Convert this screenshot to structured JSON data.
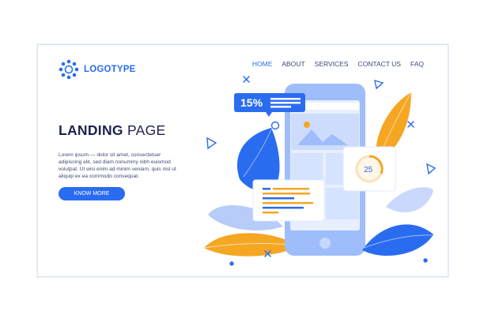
{
  "brand": {
    "logo_text": "LOGOTYPE"
  },
  "nav": {
    "home": "HOME",
    "about": "ABOUT",
    "services": "SERVICES",
    "contact": "CONTACT US",
    "faq": "FAQ"
  },
  "hero": {
    "title_bold": "LANDING",
    "title_light": " PAGE",
    "body": "Lorem ipsum — dolor sit amet, consectetuer adipiscing elit, sed diam nonummy nibh euismod volutpat. Ut wisi enim ad minim veniam, quis  nisl ut aliquip ex ea commodo consequat.",
    "cta_label": "KNOW MORE"
  },
  "illustration": {
    "discount_badge": "15%",
    "counter_value": "25",
    "icons": [
      "search-icon",
      "mountain-image-icon",
      "triangle-decor-icon",
      "cross-decor-icon",
      "circle-decor-icon"
    ]
  },
  "colors": {
    "accent": "#2a6cf0",
    "dark_text": "#1c2150",
    "orange": "#f5a623",
    "light_blue": "#a9c4fb"
  }
}
